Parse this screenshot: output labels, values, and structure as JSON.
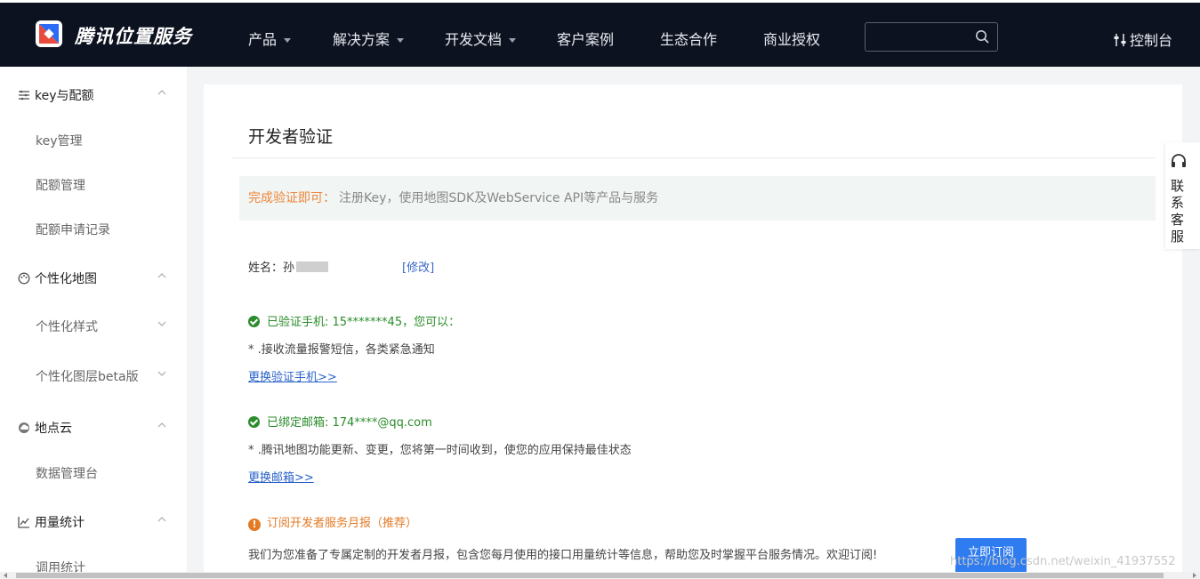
{
  "header": {
    "brand": "腾讯位置服务",
    "nav": [
      {
        "label": "产品",
        "has_caret": true
      },
      {
        "label": "解决方案",
        "has_caret": true
      },
      {
        "label": "开发文档",
        "has_caret": true
      },
      {
        "label": "客户案例",
        "has_caret": false
      },
      {
        "label": "生态合作",
        "has_caret": false
      },
      {
        "label": "商业授权",
        "has_caret": false
      }
    ],
    "search_placeholder": "",
    "console_label": "控制台"
  },
  "sidebar": {
    "groups": [
      {
        "label": "key与配额",
        "icon": "list-icon",
        "items": [
          "key管理",
          "配额管理",
          "配额申请记录"
        ]
      },
      {
        "label": "个性化地图",
        "icon": "palette-icon",
        "items": [
          "个性化样式",
          "个性化图层beta版"
        ]
      },
      {
        "label": "地点云",
        "icon": "cloud-icon",
        "items": [
          "数据管理台"
        ]
      },
      {
        "label": "用量统计",
        "icon": "chart-icon",
        "items": [
          "调用统计"
        ]
      }
    ]
  },
  "main": {
    "title": "开发者验证",
    "notice": {
      "highlight": "完成验证即可：",
      "text": "注册Key，使用地图SDK及WebService API等产品与服务"
    },
    "name_label": "姓名：",
    "name_value": "孙",
    "modify_label": "[修改]",
    "phone": {
      "status": "已验证手机: 15*******45，您可以：",
      "desc": "* .接收流量报警短信，各类紧急通知",
      "link": "更换验证手机>>"
    },
    "email": {
      "status": "已绑定邮箱: 174****@qq.com",
      "desc": "* .腾讯地图功能更新、变更，您将第一时间收到，使您的应用保持最佳状态",
      "link": "更换邮箱>>"
    },
    "report": {
      "title": "订阅开发者服务月报（推荐）",
      "desc": "我们为您准备了专属定制的开发者月报，包含您每月使用的接口用量统计等信息，帮助您及时掌握平台服务情况。欢迎订阅!",
      "button": "立即订阅"
    }
  },
  "customer_service": "联系客服",
  "watermark": "https://blog.csdn.net/weixin_41937552",
  "colors": {
    "header_bg": "#0d1220",
    "accent": "#2f7cf0",
    "success": "#2a8c2a",
    "warning": "#e37b25",
    "notice_highlight": "#f0853a"
  }
}
